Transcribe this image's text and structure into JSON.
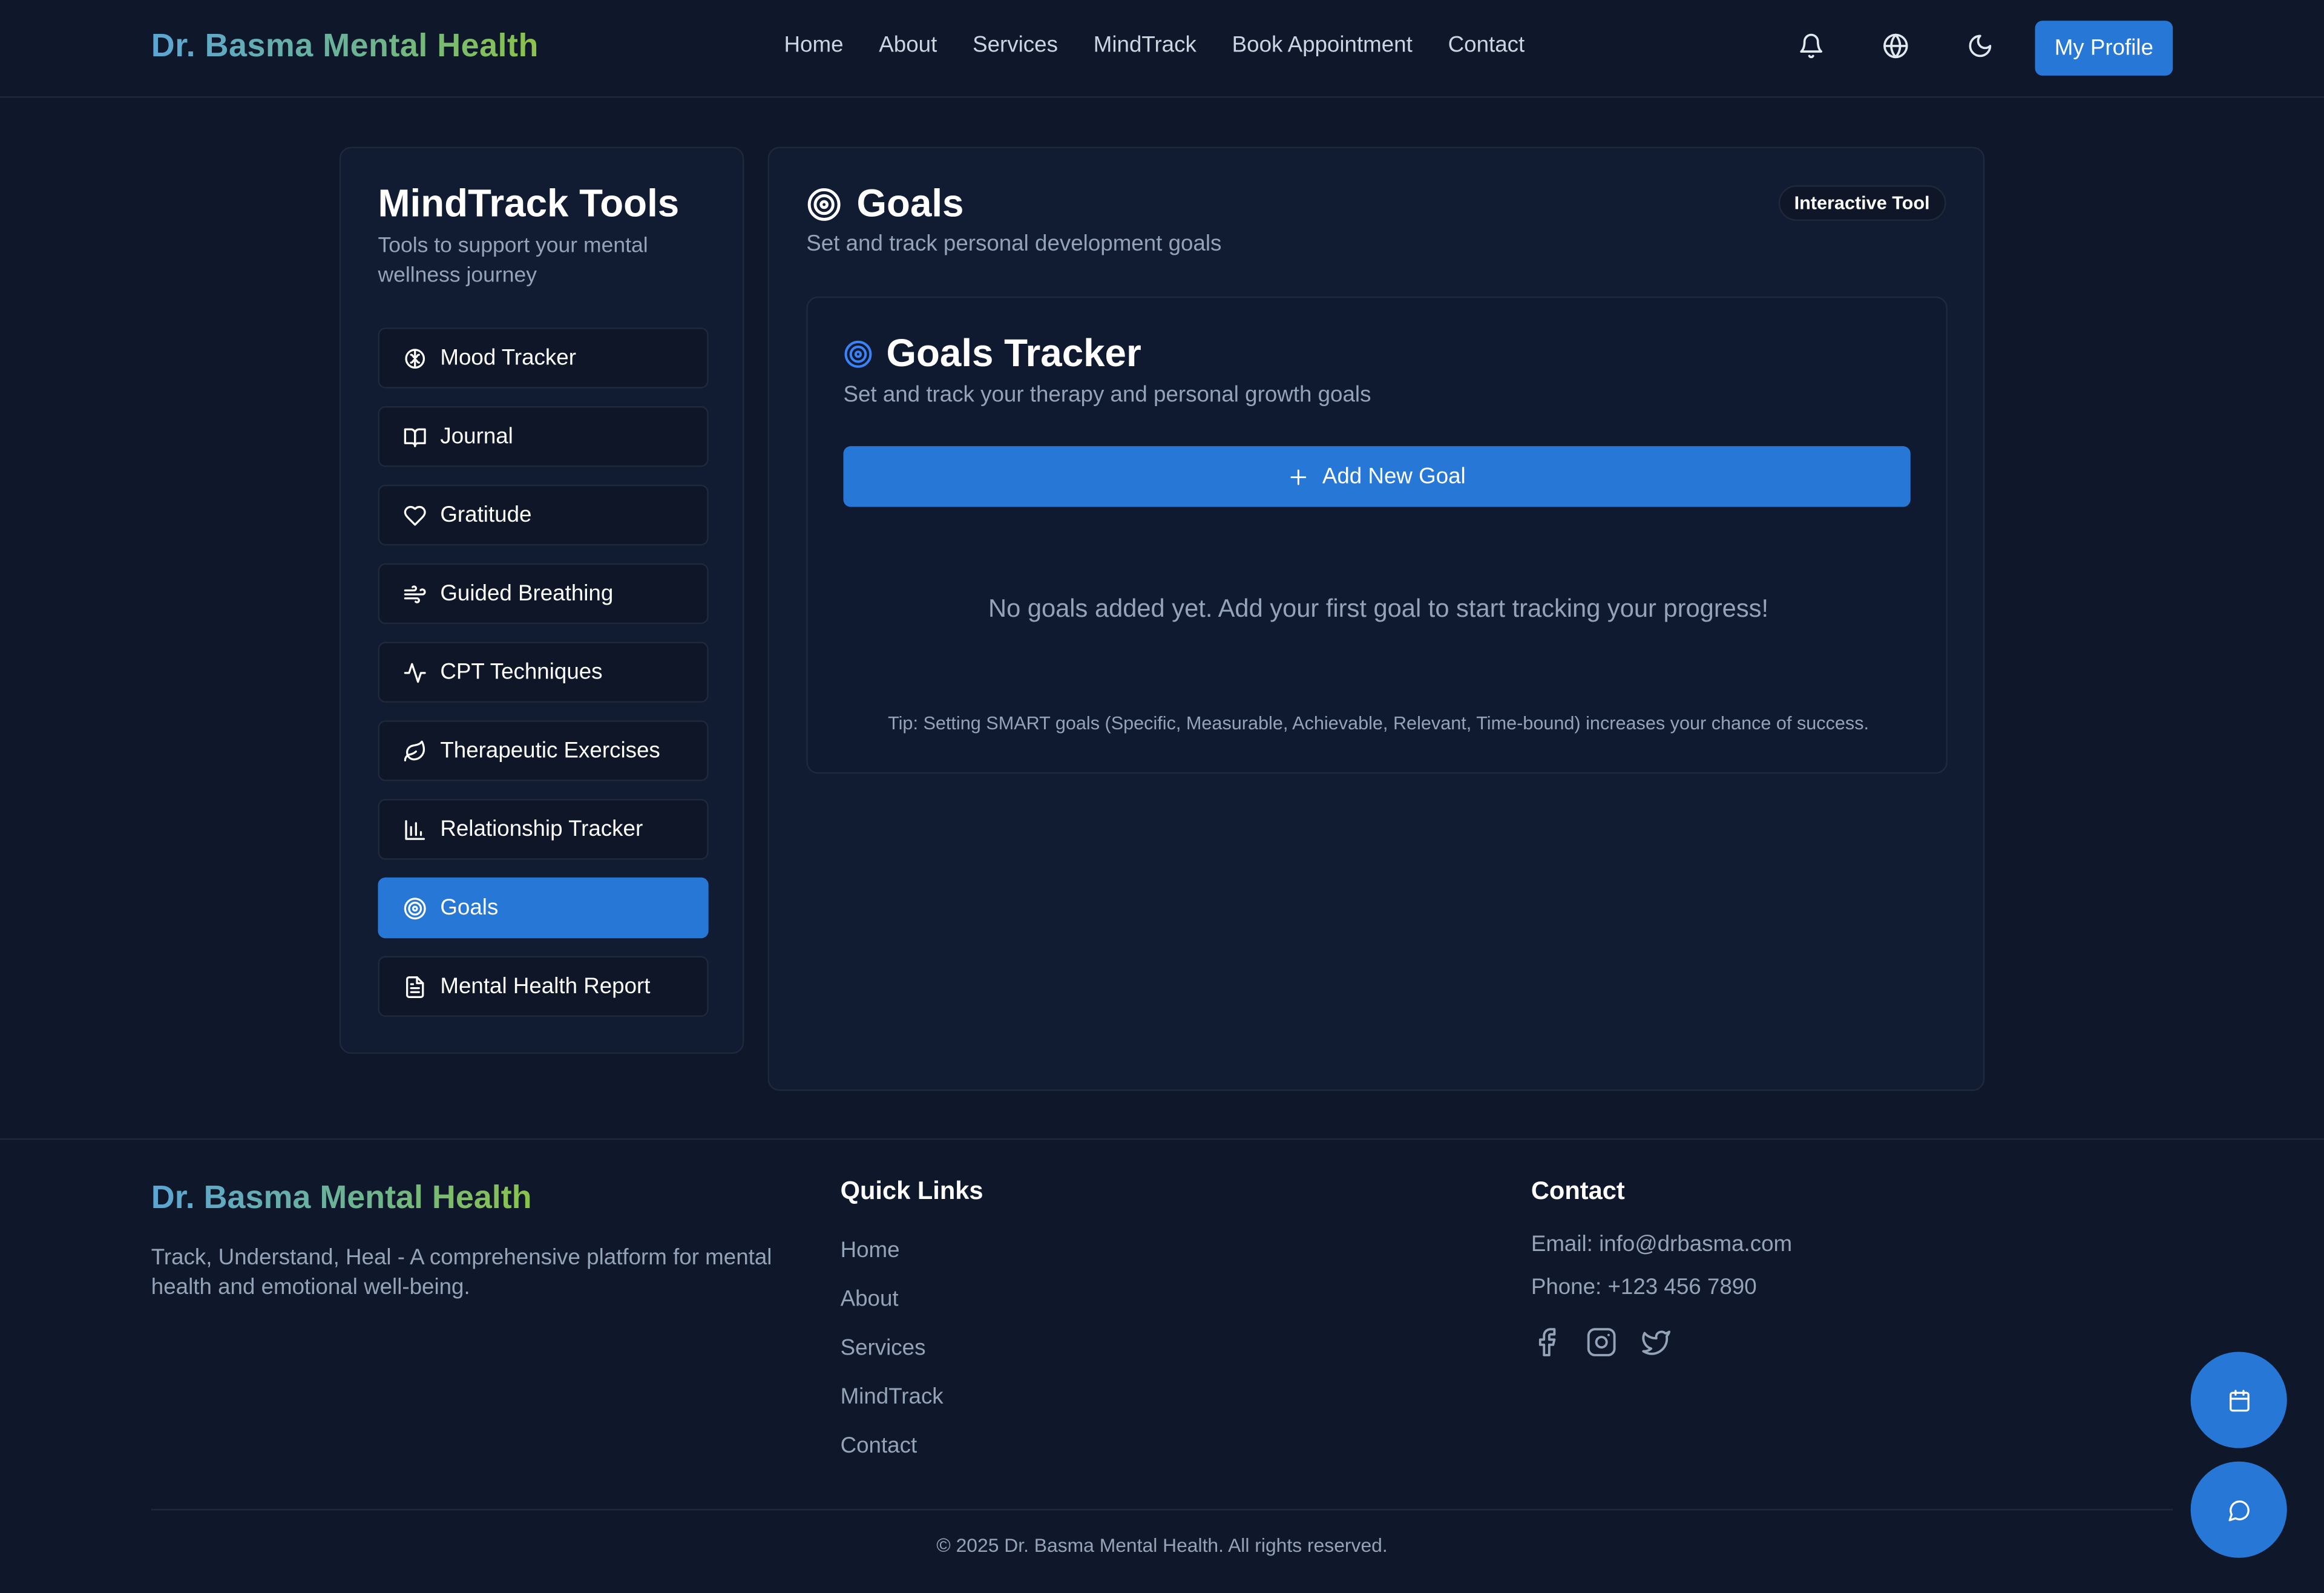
{
  "header": {
    "brand": "Dr. Basma Mental Health",
    "nav": [
      "Home",
      "About",
      "Services",
      "MindTrack",
      "Book Appointment",
      "Contact"
    ],
    "icons": [
      "bell-icon",
      "globe-icon",
      "moon-icon"
    ],
    "profile_label": "My Profile"
  },
  "sidebar": {
    "title": "MindTrack Tools",
    "subtitle": "Tools to support your mental wellness journey",
    "items": [
      {
        "label": "Mood Tracker",
        "icon": "brain-icon"
      },
      {
        "label": "Journal",
        "icon": "book-icon"
      },
      {
        "label": "Gratitude",
        "icon": "heart-icon"
      },
      {
        "label": "Guided Breathing",
        "icon": "wind-icon"
      },
      {
        "label": "CPT Techniques",
        "icon": "activity-icon"
      },
      {
        "label": "Therapeutic Exercises",
        "icon": "leaf-icon"
      },
      {
        "label": "Relationship Tracker",
        "icon": "bar-chart-icon"
      },
      {
        "label": "Goals",
        "icon": "target-icon",
        "active": true
      },
      {
        "label": "Mental Health Report",
        "icon": "file-text-icon"
      }
    ]
  },
  "main": {
    "title": "Goals",
    "subtitle": "Set and track personal development goals",
    "badge": "Interactive Tool",
    "card": {
      "title": "Goals Tracker",
      "subtitle": "Set and track your therapy and personal growth goals",
      "add_label": "Add New Goal",
      "empty_text": "No goals added yet. Add your first goal to start tracking your progress!",
      "tip": "Tip: Setting SMART goals (Specific, Measurable, Achievable, Relevant, Time-bound) increases your chance of success."
    }
  },
  "footer": {
    "brand": "Dr. Basma Mental Health",
    "description": "Track, Understand, Heal - A comprehensive platform for mental health and emotional well-being.",
    "quick_links_title": "Quick Links",
    "quick_links": [
      "Home",
      "About",
      "Services",
      "MindTrack",
      "Contact"
    ],
    "contact_title": "Contact",
    "email": "Email: info@drbasma.com",
    "phone": "Phone: +123 456 7890",
    "social": [
      "facebook-icon",
      "instagram-icon",
      "twitter-icon"
    ],
    "copyright": "© 2025 Dr. Basma Mental Health. All rights reserved."
  },
  "fabs": [
    "calendar-icon",
    "chat-icon"
  ],
  "colors": {
    "accent": "#2778d6",
    "background": "#0f172a",
    "panel": "#111c33"
  }
}
